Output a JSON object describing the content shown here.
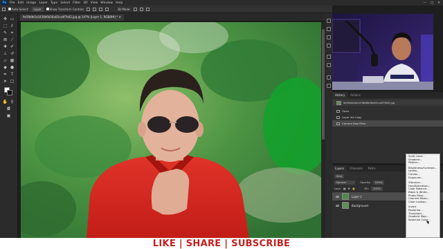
{
  "menubar": {
    "logo": "Ps",
    "items": [
      "File",
      "Edit",
      "Image",
      "Layer",
      "Type",
      "Select",
      "Filter",
      "3D",
      "View",
      "Window",
      "Help"
    ],
    "window_controls": [
      "—",
      "□",
      "✕"
    ]
  },
  "options_bar": {
    "auto_select_label": "Auto-Select:",
    "auto_select_value": "Layer",
    "transform_label": "Show Transform Controls",
    "mode_label": "3D Mode:"
  },
  "document": {
    "tab_title": "9e5fb0b5a5438d6b56a02ca4f7b62.jpg @ 147% (Layer 1, RGB/8#) *  ✕"
  },
  "history_panel": {
    "tabs": [
      "History",
      "Actions"
    ],
    "snapshot": "9e5fb0b5a5438d6b56a02ca4f7b62.jpg",
    "steps": [
      "Open",
      "Layer Via Copy",
      "Camera Raw Filter"
    ]
  },
  "layers_panel": {
    "tabs": [
      "Layers",
      "Channels",
      "Paths"
    ],
    "kind_label": "Kind",
    "blend_mode": "Normal",
    "opacity_label": "Opacity:",
    "opacity_value": "100%",
    "lock_label": "Lock:",
    "fill_label": "Fill:",
    "fill_value": "100%",
    "layers": [
      {
        "name": "Layer 1",
        "selected": true
      },
      {
        "name": "Background",
        "selected": false
      }
    ]
  },
  "adjustment_menu": {
    "group1": [
      "Solid Color...",
      "Gradient...",
      "Pattern..."
    ],
    "group2": [
      "Brightness/Contrast...",
      "Levels...",
      "Curves...",
      "Exposure..."
    ],
    "group3": [
      "Vibrance...",
      "Hue/Saturation...",
      "Color Balance...",
      "Black & White...",
      "Photo Filter...",
      "Channel Mixer...",
      "Color Lookup..."
    ],
    "group4": [
      "Invert",
      "Posterize...",
      "Threshold...",
      "Gradient Map...",
      "Selective Color..."
    ]
  },
  "banner": {
    "text": "LIKE | SHARE | SUBSCRIBE"
  },
  "colors": {
    "banner_text": "#c4201e",
    "app_bg": "#2b2b2b",
    "panel_bg": "#2f2f2f",
    "menu_bg": "#f2f2f2"
  },
  "icons": {
    "tools": [
      "move-tool-icon",
      "artboard-icon",
      "marquee-icon",
      "lasso-icon",
      "quick-select-icon",
      "crop-icon",
      "frame-icon",
      "eyedropper-icon",
      "healing-brush-icon",
      "brush-icon",
      "clone-stamp-icon",
      "history-brush-icon",
      "eraser-icon",
      "gradient-icon",
      "blur-icon",
      "dodge-icon",
      "pen-icon",
      "type-icon",
      "path-select-icon",
      "rectangle-icon",
      "hand-icon",
      "zoom-icon"
    ]
  }
}
